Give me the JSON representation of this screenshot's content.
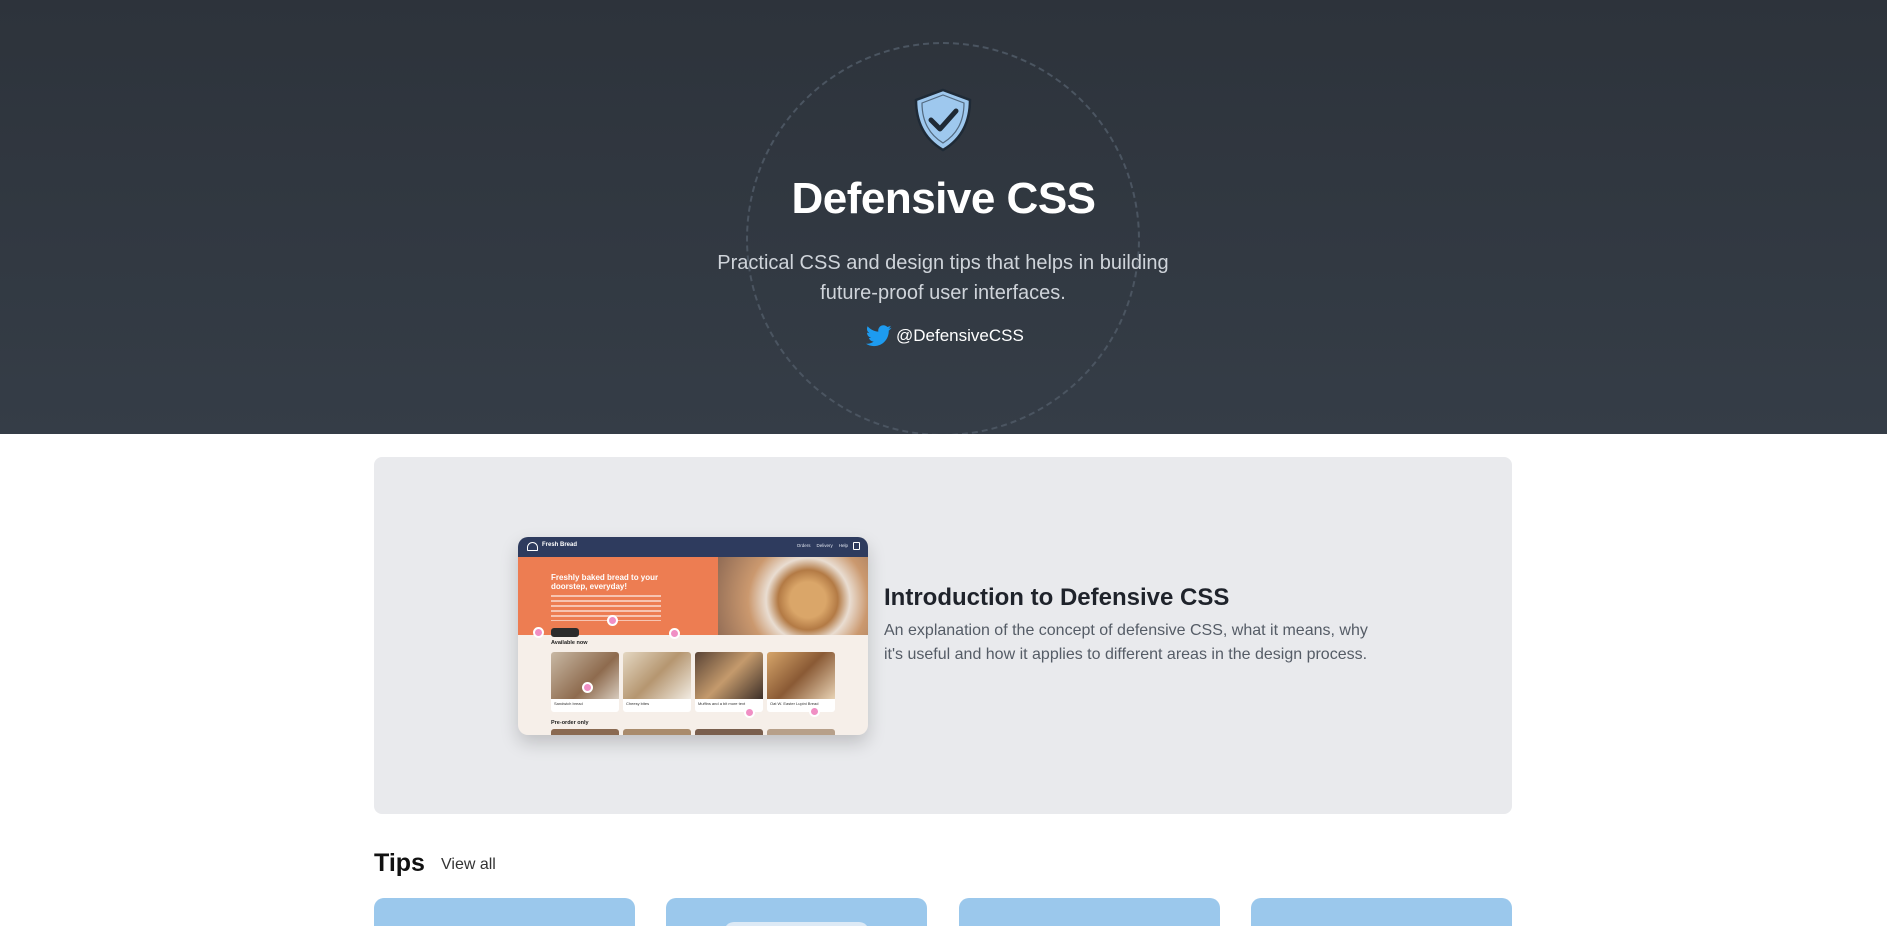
{
  "hero": {
    "title": "Defensive CSS",
    "description": "Practical CSS and design tips that helps in building future-proof user interfaces.",
    "twitter_handle": "@DefensiveCSS",
    "shield_icon": "shield-check-icon",
    "twitter_icon": "twitter-bird-icon"
  },
  "intro": {
    "title": "Introduction to Defensive CSS",
    "description": "An explanation of the concept of defensive CSS, what it means, why it's useful and how it applies to different areas in the design process.",
    "thumbnail": {
      "brand": "Fresh Bread",
      "nav_links": [
        "Orders",
        "Delivery",
        "Help"
      ],
      "headline": "Freshly baked bread to your doorstep, everyday!",
      "section_available": "Available now",
      "section_preorder": "Pre-order only",
      "products": [
        "Sandwich bread",
        "Cheesy bites",
        "Muffins and a bit more text",
        "Oat W. Easter Lupini Bread"
      ]
    }
  },
  "tips": {
    "heading": "Tips",
    "view_all": "View all"
  },
  "colors": {
    "hero_bg": "#2d333b",
    "card_bg": "#e9eaed",
    "tip_card_bg": "#9bc8ec",
    "shield_fill": "#9ec8ee",
    "twitter_blue": "#1d9bf0"
  }
}
